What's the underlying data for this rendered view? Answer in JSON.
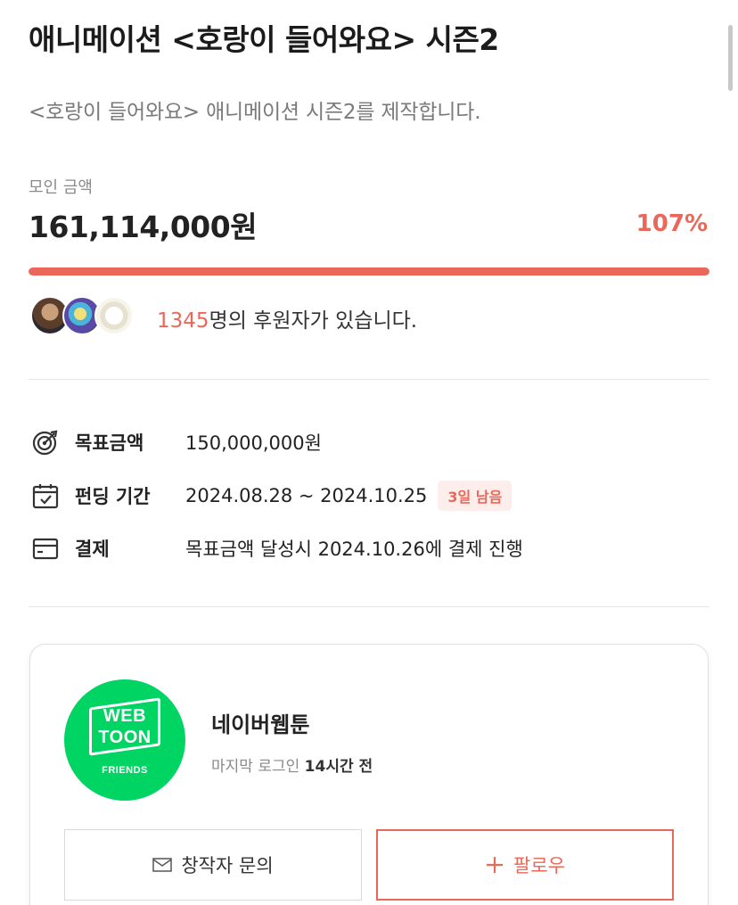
{
  "project": {
    "title": "애니메이션 <호랑이 들어와요> 시즌2",
    "subtitle": "<호랑이 들어와요> 애니메이션 시즌2를 제작합니다."
  },
  "funding": {
    "raised_label": "모인 금액",
    "raised_amount": "161,114,000원",
    "percent_text": "107%",
    "progress_fraction": 1.0,
    "accent_color": "#e9685a"
  },
  "supporters": {
    "count": "1345",
    "suffix": "명의 후원자가 있습니다."
  },
  "details": {
    "goal_label": "목표금액",
    "goal_value": "150,000,000원",
    "period_label": "펀딩 기간",
    "period_value": "2024.08.28 ~ 2024.10.25",
    "remaining_badge": "3일 남음",
    "payment_label": "결제",
    "payment_value": "목표금액 달성시 2024.10.26에 결제 진행"
  },
  "creator": {
    "logo_line1": "WEB",
    "logo_line2": "TOON",
    "logo_line3": "FRIENDS",
    "logo_color": "#00d564",
    "name": "네이버웹툰",
    "last_login_prefix": "마지막 로그인",
    "last_login_value": "14시간 전"
  },
  "actions": {
    "contact_label": "창작자 문의",
    "follow_label": "팔로우"
  },
  "icons": [
    "target-icon",
    "calendar-icon",
    "card-icon",
    "mail-icon",
    "plus-icon"
  ]
}
